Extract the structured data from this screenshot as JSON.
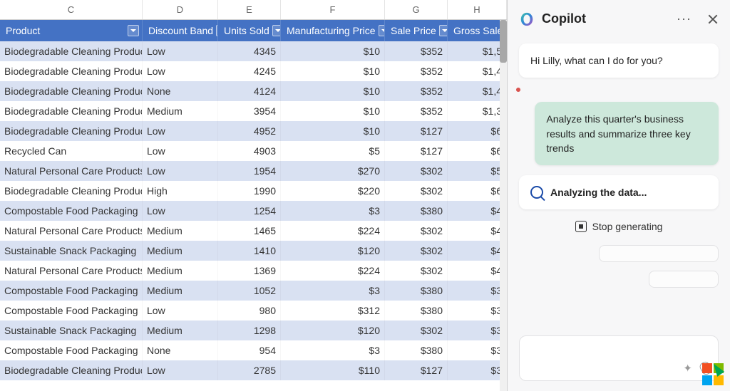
{
  "columns": {
    "letters": [
      "C",
      "D",
      "E",
      "F",
      "G",
      "H"
    ],
    "headers": [
      "Product",
      "Discount Band",
      "Units Sold",
      "Manufacturing Price",
      "Sale Price",
      "Gross Sale"
    ]
  },
  "rows": [
    {
      "product": "Biodegradable Cleaning Products",
      "band": "Low",
      "units": "4345",
      "mfg": "$10",
      "sale": "$352",
      "gross": "$1,5"
    },
    {
      "product": "Biodegradable Cleaning Products",
      "band": "Low",
      "units": "4245",
      "mfg": "$10",
      "sale": "$352",
      "gross": "$1,4"
    },
    {
      "product": "Biodegradable Cleaning Products",
      "band": "None",
      "units": "4124",
      "mfg": "$10",
      "sale": "$352",
      "gross": "$1,4"
    },
    {
      "product": "Biodegradable Cleaning Products",
      "band": "Medium",
      "units": "3954",
      "mfg": "$10",
      "sale": "$352",
      "gross": "$1,3"
    },
    {
      "product": "Biodegradable Cleaning Products",
      "band": "Low",
      "units": "4952",
      "mfg": "$10",
      "sale": "$127",
      "gross": "$6"
    },
    {
      "product": "Recycled Can",
      "band": "Low",
      "units": "4903",
      "mfg": "$5",
      "sale": "$127",
      "gross": "$6"
    },
    {
      "product": "Natural Personal Care Products",
      "band": "Low",
      "units": "1954",
      "mfg": "$270",
      "sale": "$302",
      "gross": "$5"
    },
    {
      "product": "Biodegradable Cleaning Products",
      "band": "High",
      "units": "1990",
      "mfg": "$220",
      "sale": "$302",
      "gross": "$6"
    },
    {
      "product": "Compostable Food Packaging",
      "band": "Low",
      "units": "1254",
      "mfg": "$3",
      "sale": "$380",
      "gross": "$4"
    },
    {
      "product": "Natural Personal Care Products",
      "band": "Medium",
      "units": "1465",
      "mfg": "$224",
      "sale": "$302",
      "gross": "$4"
    },
    {
      "product": "Sustainable Snack Packaging",
      "band": "Medium",
      "units": "1410",
      "mfg": "$120",
      "sale": "$302",
      "gross": "$4"
    },
    {
      "product": "Natural Personal Care Products",
      "band": "Medium",
      "units": "1369",
      "mfg": "$224",
      "sale": "$302",
      "gross": "$4"
    },
    {
      "product": "Compostable Food Packaging",
      "band": "Medium",
      "units": "1052",
      "mfg": "$3",
      "sale": "$380",
      "gross": "$3"
    },
    {
      "product": "Compostable Food Packaging",
      "band": "Low",
      "units": "980",
      "mfg": "$312",
      "sale": "$380",
      "gross": "$3"
    },
    {
      "product": "Sustainable Snack Packaging",
      "band": "Medium",
      "units": "1298",
      "mfg": "$120",
      "sale": "$302",
      "gross": "$3"
    },
    {
      "product": "Compostable Food Packaging",
      "band": "None",
      "units": "954",
      "mfg": "$3",
      "sale": "$380",
      "gross": "$3"
    },
    {
      "product": "Biodegradable Cleaning Products",
      "band": "Low",
      "units": "2785",
      "mfg": "$110",
      "sale": "$127",
      "gross": "$3"
    }
  ],
  "copilot": {
    "title": "Copilot",
    "greeting": "Hi Lilly, what can I do for you?",
    "user_prompt": "Analyze this quarter's business results and summarize three key trends",
    "status": "Analyzing the data...",
    "stop_label": "Stop generating"
  }
}
